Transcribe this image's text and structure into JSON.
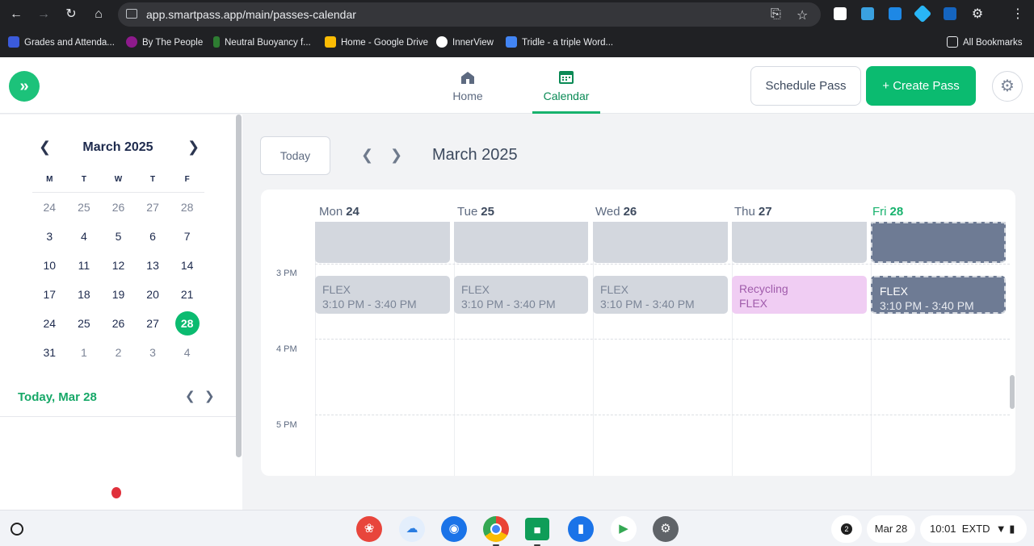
{
  "browser": {
    "url": "app.smartpass.app/main/passes-calendar",
    "bookmarks": [
      {
        "label": "Grades and Attenda...",
        "icon": "sis-icon",
        "color": "#3b5bdb"
      },
      {
        "label": "By The People",
        "icon": "p-icon",
        "color": "#8e1a8c"
      },
      {
        "label": "Neutral Buoyancy f...",
        "icon": "leaf-icon",
        "color": "#2e7d32"
      },
      {
        "label": "Home - Google Drive",
        "icon": "drive-icon",
        "color": "#fbbc04"
      },
      {
        "label": "InnerView",
        "icon": "innerview-icon",
        "color": "#ffffff"
      },
      {
        "label": "Tridle - a triple Word...",
        "icon": "tridle-icon",
        "color": "#4285f4"
      }
    ],
    "all_bookmarks": "All Bookmarks"
  },
  "header": {
    "tabs": [
      {
        "label": "Home",
        "icon": "school-icon"
      },
      {
        "label": "Calendar",
        "icon": "calendar-icon"
      }
    ],
    "schedule_pass": "Schedule Pass",
    "create_pass": "+ Create Pass",
    "brand_color": "#0bbb70"
  },
  "mini_calendar": {
    "title": "March 2025",
    "weekdays": [
      "M",
      "T",
      "W",
      "T",
      "F"
    ],
    "weeks": [
      [
        {
          "d": "24",
          "m": true
        },
        {
          "d": "25",
          "m": true
        },
        {
          "d": "26",
          "m": true
        },
        {
          "d": "27",
          "m": true
        },
        {
          "d": "28",
          "m": true
        }
      ],
      [
        {
          "d": "3"
        },
        {
          "d": "4"
        },
        {
          "d": "5"
        },
        {
          "d": "6"
        },
        {
          "d": "7"
        }
      ],
      [
        {
          "d": "10"
        },
        {
          "d": "11"
        },
        {
          "d": "12"
        },
        {
          "d": "13"
        },
        {
          "d": "14"
        }
      ],
      [
        {
          "d": "17"
        },
        {
          "d": "18"
        },
        {
          "d": "19"
        },
        {
          "d": "20"
        },
        {
          "d": "21"
        }
      ],
      [
        {
          "d": "24"
        },
        {
          "d": "25"
        },
        {
          "d": "26"
        },
        {
          "d": "27"
        },
        {
          "d": "28",
          "t": true
        }
      ],
      [
        {
          "d": "31"
        },
        {
          "d": "1",
          "m": true
        },
        {
          "d": "2",
          "m": true
        },
        {
          "d": "3",
          "m": true
        },
        {
          "d": "4",
          "m": true
        }
      ]
    ],
    "today_label": "Today, Mar 28"
  },
  "main": {
    "today_button": "Today",
    "title": "March 2025",
    "columns": [
      {
        "dow": "Mon",
        "day": "24"
      },
      {
        "dow": "Tue",
        "day": "25"
      },
      {
        "dow": "Wed",
        "day": "26"
      },
      {
        "dow": "Thu",
        "day": "27"
      },
      {
        "dow": "Fri",
        "day": "28",
        "today": true
      }
    ],
    "times": [
      "3 PM",
      "4 PM",
      "5 PM"
    ],
    "events": [
      {
        "title": "FLEX",
        "time": "3:10 PM - 3:40 PM",
        "style": "grey"
      },
      {
        "title": "FLEX",
        "time": "3:10 PM - 3:40 PM",
        "style": "grey"
      },
      {
        "title": "FLEX",
        "time": "3:10 PM - 3:40 PM",
        "style": "grey"
      },
      {
        "title": "Recycling",
        "time": "FLEX",
        "style": "pink"
      },
      {
        "title": "FLEX",
        "time": "3:10 PM - 3:40 PM",
        "style": "dark"
      }
    ]
  },
  "shelf": {
    "notification_count": "2",
    "date": "Mar 28",
    "time": "10:01",
    "status": "EXTD"
  }
}
